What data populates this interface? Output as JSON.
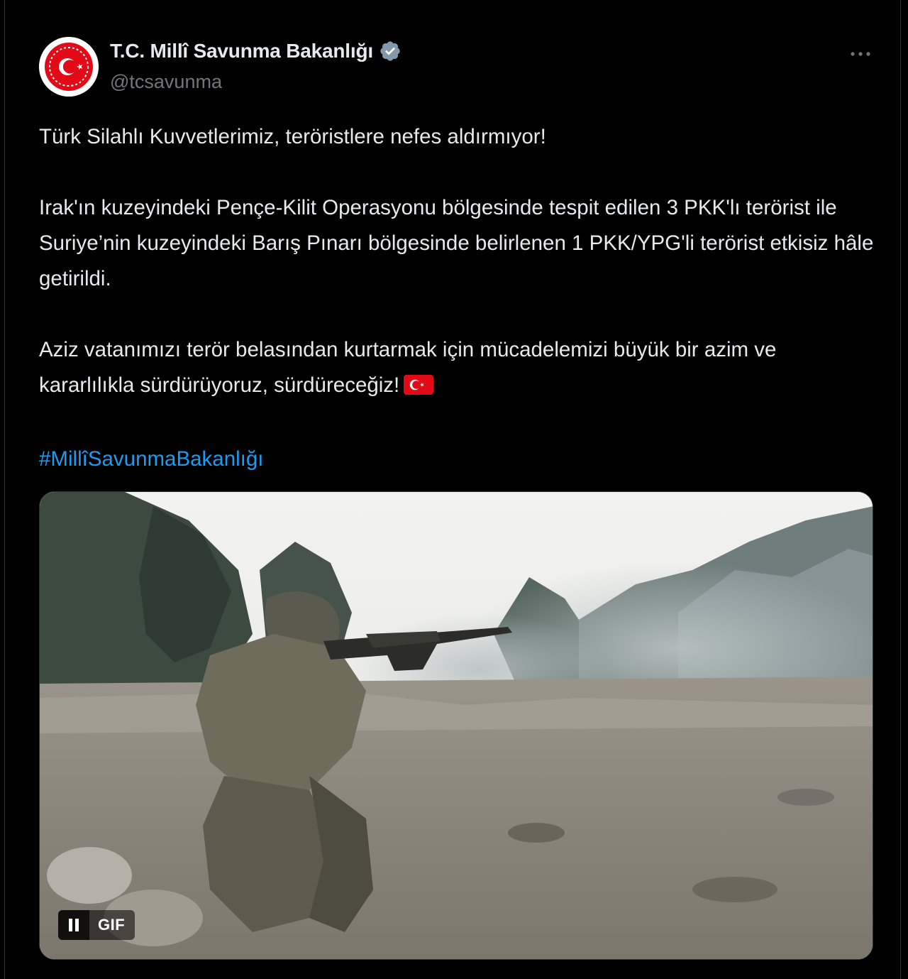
{
  "author": {
    "display_name": "T.C. Millî Savunma Bakanlığı",
    "handle": "@tcsavunma",
    "verified": true,
    "verified_badge_color": "#829aab",
    "avatar_icon": "ministry-emblem-icon",
    "avatar_color": "#e30a17"
  },
  "menu": {
    "icon": "more-options-icon"
  },
  "tweet": {
    "paragraphs": [
      "Türk Silahlı Kuvvetlerimiz, teröristlere nefes aldırmıyor!",
      "Irak'ın kuzeyindeki Pençe-Kilit Operasyonu bölgesinde tespit edilen 3 PKK'lı terörist ile Suriye’nin kuzeyindeki Barış Pınarı bölgesinde belirlenen 1 PKK/YPG'li terörist etkisiz hâle getirildi.",
      "Aziz vatanımızı terör belasından kurtarmak için mücadelemizi büyük bir azim ve kararlılıkla sürdürüyoruz, sürdüreceğiz!"
    ],
    "flag_emoji_icon": "turkish-flag-icon",
    "hashtag": "#MillîSavunmaBakanlığı",
    "hashtag_color": "#1d9bf0"
  },
  "media": {
    "type": "gif",
    "badge": "GIF",
    "control_icon": "pause-icon"
  }
}
